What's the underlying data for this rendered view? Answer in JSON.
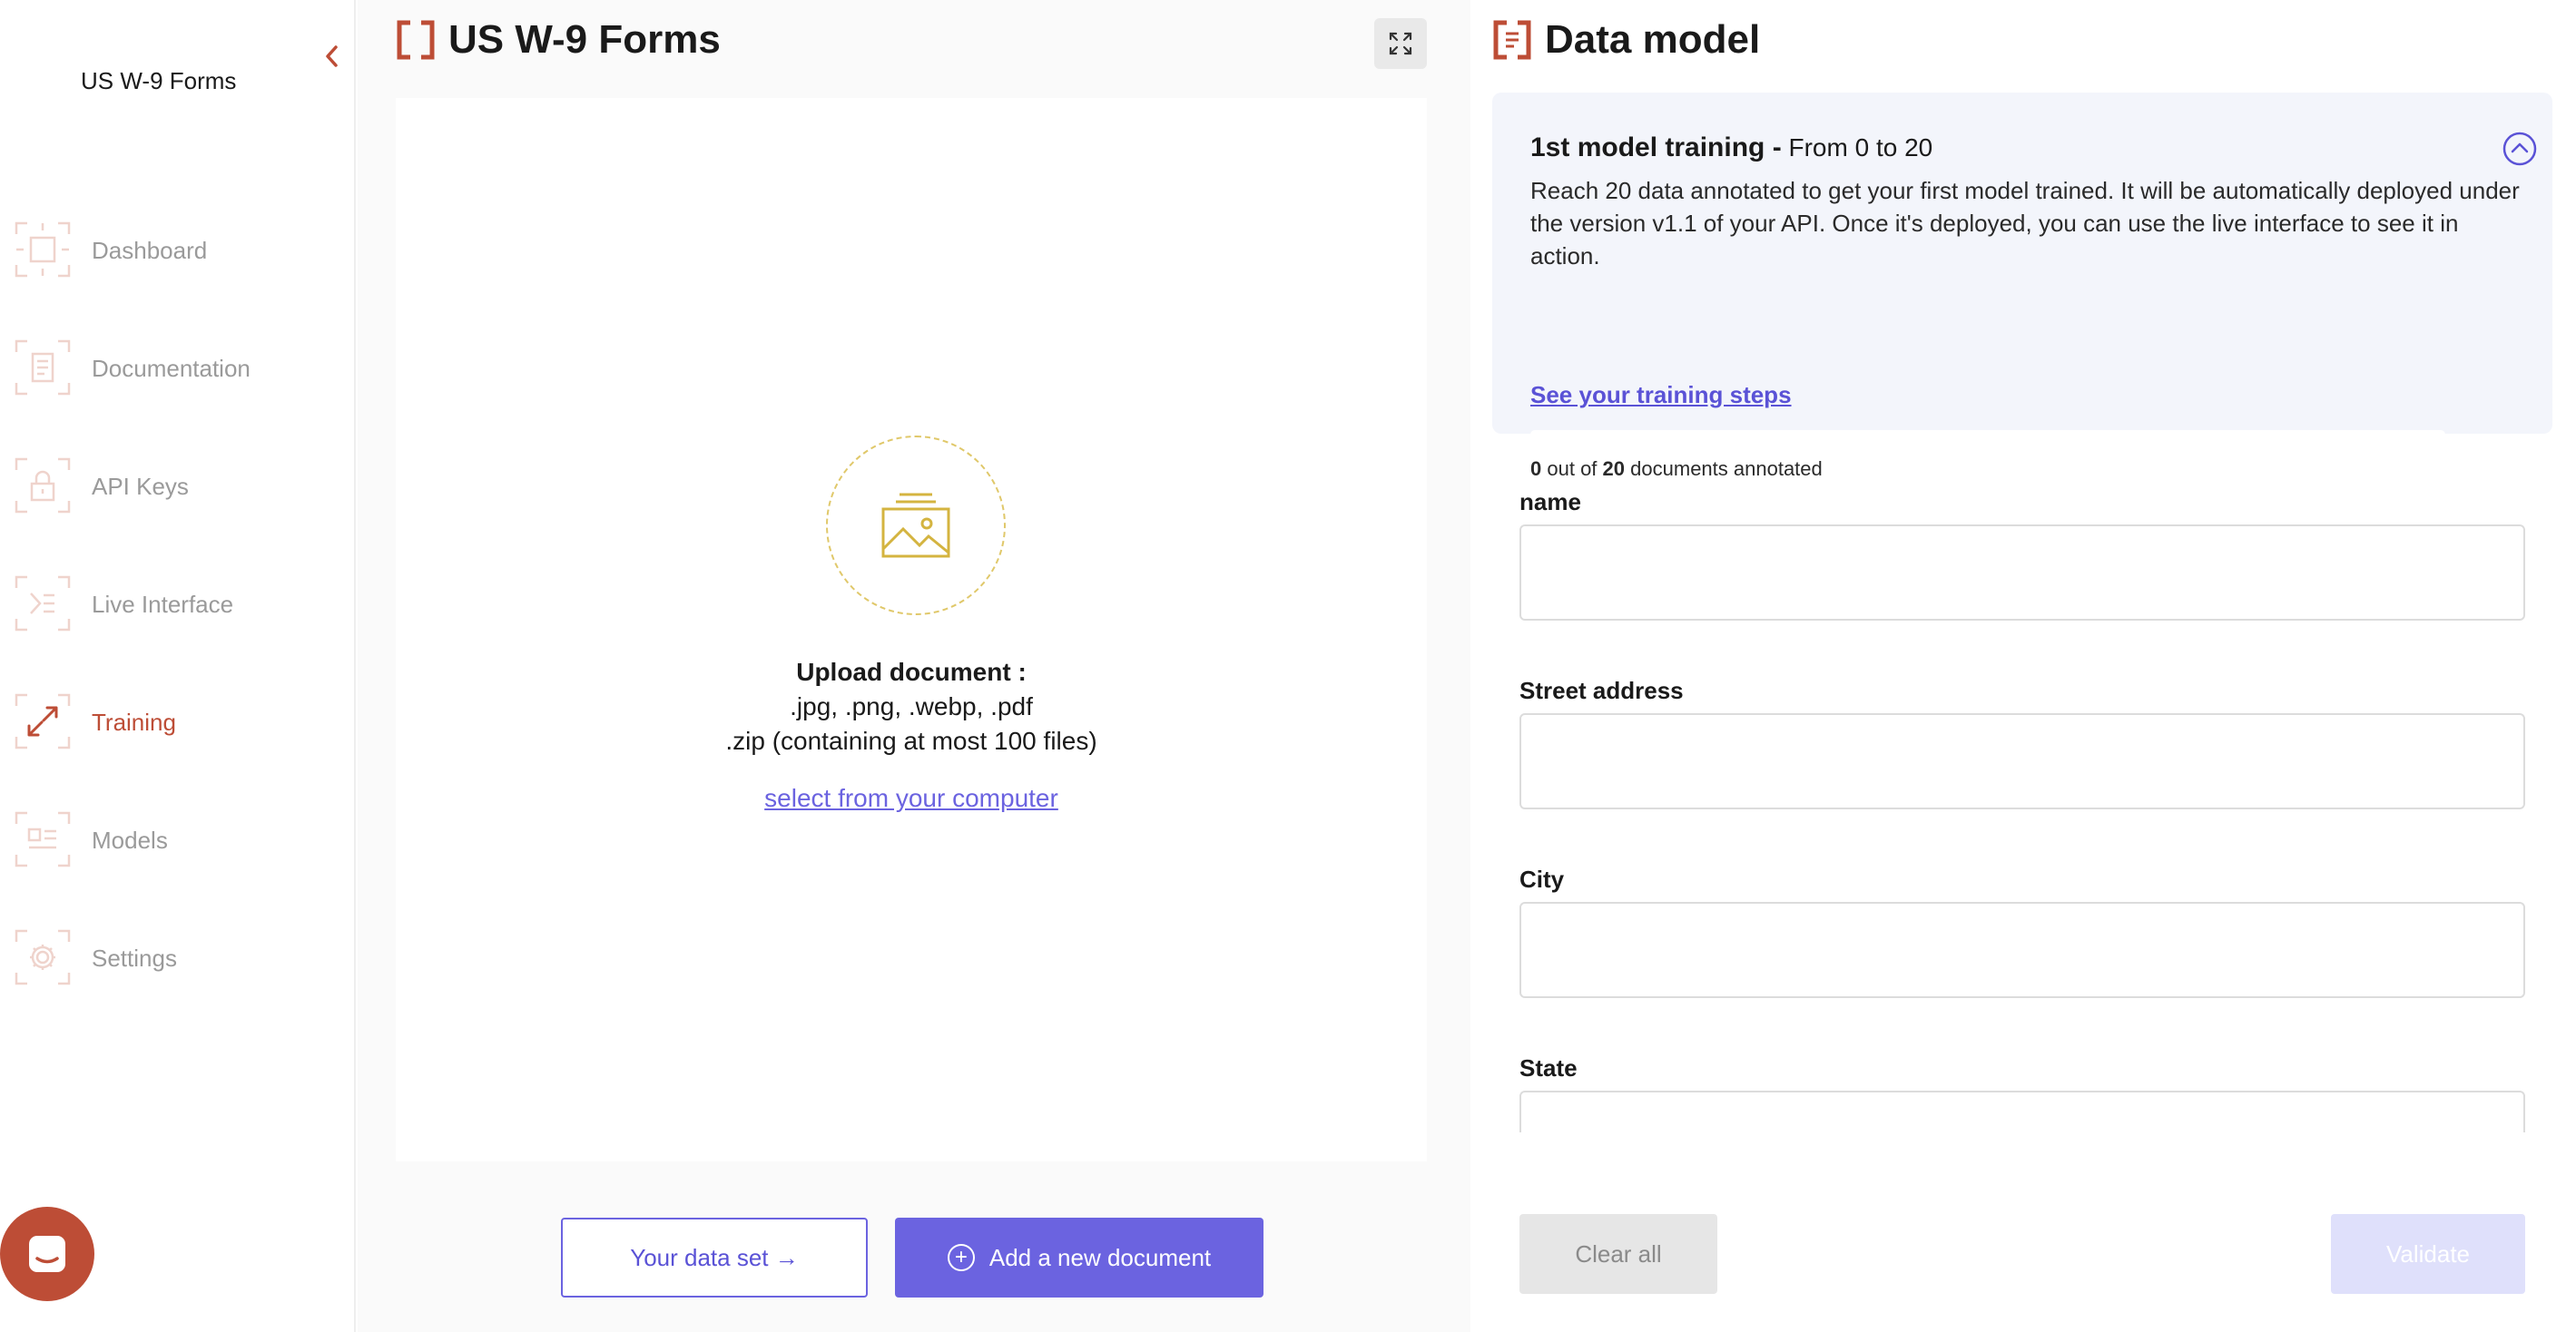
{
  "sidebar": {
    "app_title": "US W-9 Forms",
    "items": [
      {
        "label": "Dashboard",
        "icon": "dashboard-icon"
      },
      {
        "label": "Documentation",
        "icon": "documentation-icon"
      },
      {
        "label": "API Keys",
        "icon": "lock-icon"
      },
      {
        "label": "Live Interface",
        "icon": "live-interface-icon"
      },
      {
        "label": "Training",
        "icon": "training-icon",
        "active": true
      },
      {
        "label": "Models",
        "icon": "models-icon"
      },
      {
        "label": "Settings",
        "icon": "gear-icon"
      }
    ]
  },
  "middle": {
    "title": "US W-9 Forms",
    "upload": {
      "heading": "Upload document :",
      "formats": ".jpg, .png, .webp, .pdf",
      "zip_note": ".zip (containing at most 100 files)",
      "select_link": "select from your computer"
    },
    "dataset_button": "Your data set →",
    "add_button": "Add a new document"
  },
  "right": {
    "title": "Data model",
    "training_card": {
      "heading": "1st model training -",
      "range": "From 0 to 20",
      "body": "Reach 20 data annotated to get your first model trained. It will be automatically deployed under the version v1.1 of your API. Once it's deployed, you can use the live interface to see it in action.",
      "steps_link": "See your training steps",
      "annotated": "0",
      "out_of_text": "out of",
      "total": "20",
      "suffix": "documents annotated",
      "progress_fraction": 0
    },
    "fields": [
      {
        "label": "name",
        "value": ""
      },
      {
        "label": "Street address",
        "value": ""
      },
      {
        "label": "City",
        "value": ""
      },
      {
        "label": "State",
        "value": ""
      }
    ],
    "clear_button": "Clear all",
    "validate_button": "Validate"
  },
  "colors": {
    "brand": "#bd4d36",
    "accent": "#6b63e0",
    "upload_accent": "#d4b440"
  }
}
